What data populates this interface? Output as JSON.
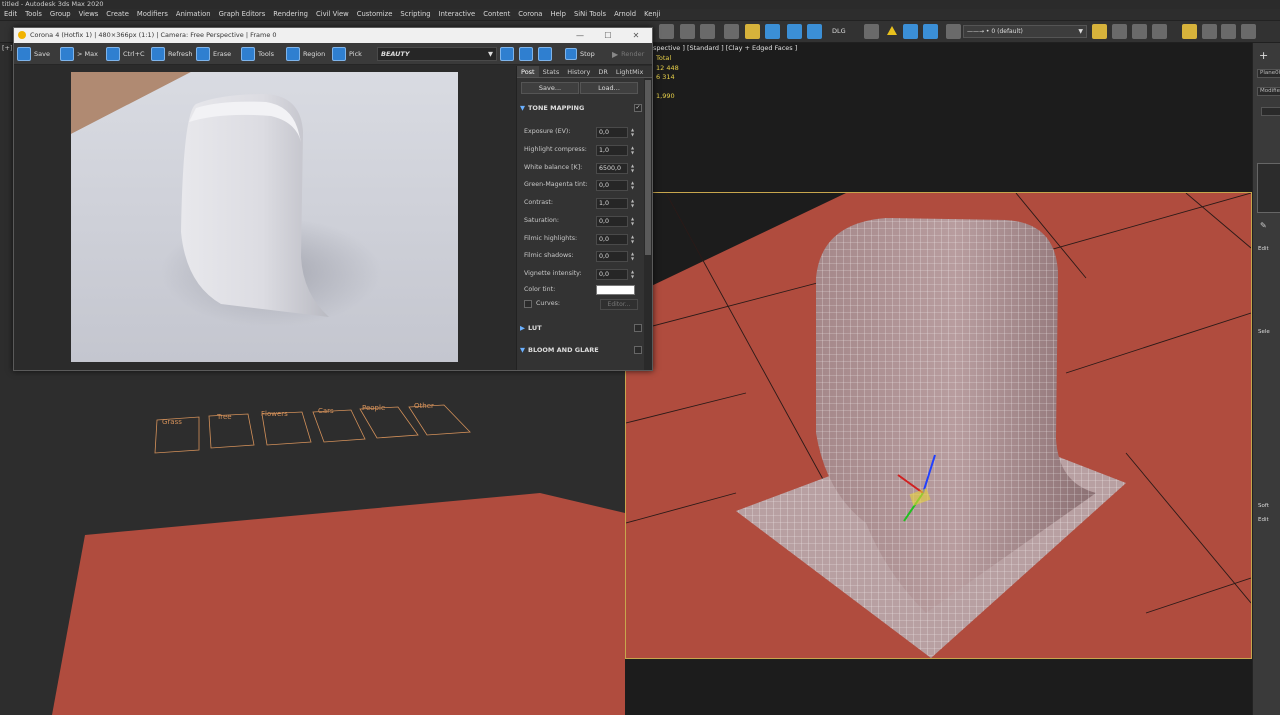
{
  "window": {
    "title": "titled - Autodesk 3ds Max 2020"
  },
  "menubar": [
    "Edit",
    "Tools",
    "Group",
    "Views",
    "Create",
    "Modifiers",
    "Animation",
    "Graph Editors",
    "Rendering",
    "Civil View",
    "Customize",
    "Scripting",
    "Interactive",
    "Content",
    "Corona",
    "Help",
    "SiNi Tools",
    "Arnold",
    "Kenji"
  ],
  "toolbar": {
    "dlg_label": "DLG",
    "layer_dropdown": "——→ • 0 (default)"
  },
  "viewport_left": {
    "label": "[+]"
  },
  "viewport_right": {
    "label": "spective ] [Standard ] [Clay + Edged Faces ]",
    "stats_header": "Total",
    "stats": [
      "12 448",
      "6 314",
      "1,990"
    ]
  },
  "scene_labels": [
    "Grass",
    "Tree",
    "Flowers",
    "Cars",
    "People",
    "Other"
  ],
  "command_panel": {
    "fields": [
      "Plane00",
      "Modifier"
    ],
    "rollouts": [
      "Edit",
      "Sele",
      "Soft",
      "Edit"
    ]
  },
  "vfb": {
    "title": "Corona 4 (Hotfix 1) | 480×366px (1:1) | Camera: Free Perspective | Frame 0",
    "toolbar": {
      "save": "Save",
      "to_max": "> Max",
      "copy": "Ctrl+C",
      "refresh": "Refresh",
      "erase": "Erase",
      "tools": "Tools",
      "region": "Region",
      "pick": "Pick",
      "stop": "Stop",
      "render": "Render"
    },
    "render_element": "BEAUTY",
    "tabs": [
      "Post",
      "Stats",
      "History",
      "DR",
      "LightMix"
    ],
    "save_btn": "Save...",
    "load_btn": "Load...",
    "tone_mapping": {
      "header": "TONE MAPPING",
      "rows": [
        {
          "label": "Exposure (EV):",
          "value": "0,0"
        },
        {
          "label": "Highlight compress:",
          "value": "1,0"
        },
        {
          "label": "White balance [K]:",
          "value": "6500,0"
        },
        {
          "label": "Green-Magenta tint:",
          "value": "0,0"
        },
        {
          "label": "Contrast:",
          "value": "1,0"
        },
        {
          "label": "Saturation:",
          "value": "0,0"
        },
        {
          "label": "Filmic highlights:",
          "value": "0,0"
        },
        {
          "label": "Filmic shadows:",
          "value": "0,0"
        },
        {
          "label": "Vignette intensity:",
          "value": "0,0"
        }
      ],
      "color_tint": "Color tint:",
      "curves": "Curves:",
      "editor": "Editor..."
    },
    "lut": "LUT",
    "bloom": "BLOOM AND GLARE"
  },
  "colors": {
    "floor": "#b04c3e",
    "viewport_border": "#c7a64d",
    "accent": "#2f7fd0",
    "stats": "#e8d14a"
  }
}
